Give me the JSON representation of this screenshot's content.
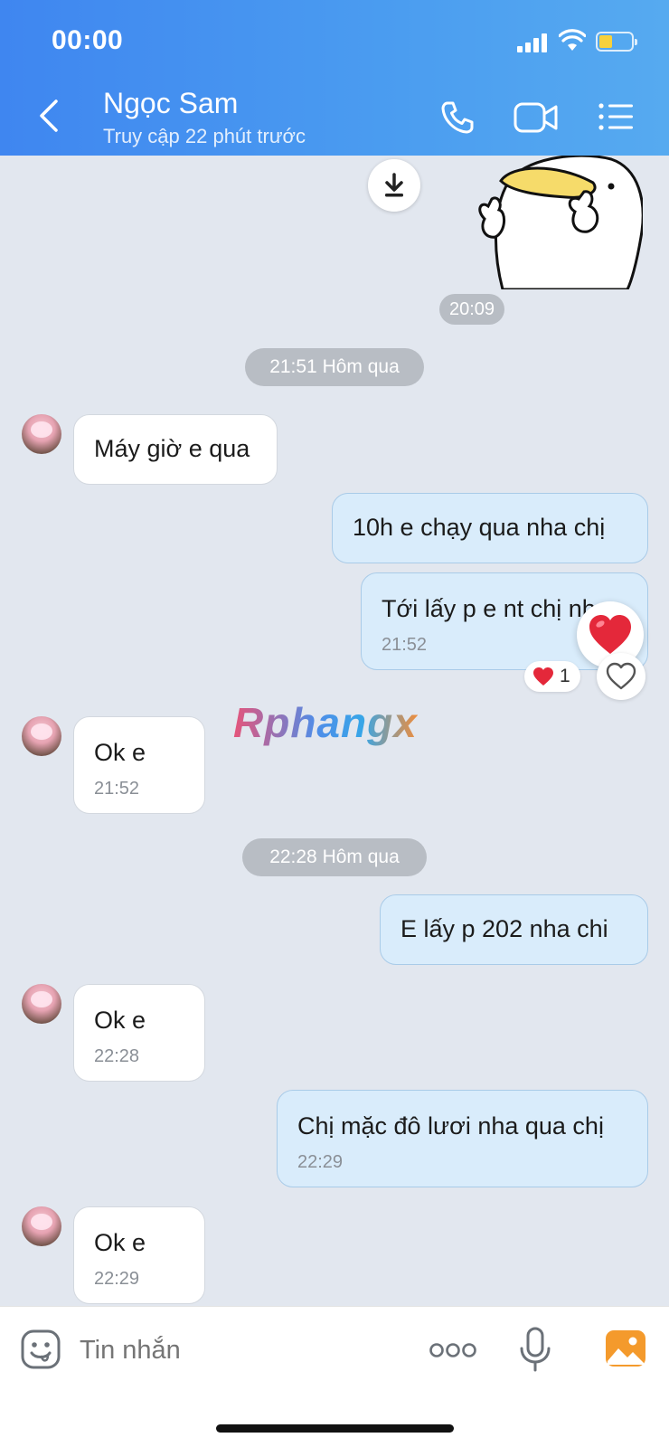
{
  "status_bar": {
    "time": "00:00"
  },
  "header": {
    "contact_name": "Ngọc Sam",
    "contact_status": "Truy cập 22 phút trước"
  },
  "messages": [
    {
      "type": "sticker",
      "direction": "out",
      "time": "20:09"
    },
    {
      "type": "divider",
      "text": "21:51 Hôm qua"
    },
    {
      "type": "text",
      "direction": "in",
      "text": "Máy giờ e qua"
    },
    {
      "type": "text",
      "direction": "out",
      "text": "10h e chạy qua nha chị"
    },
    {
      "type": "text",
      "direction": "out",
      "text": "Tới lấy p e nt chị nh",
      "time": "21:52",
      "reaction": {
        "emoji": "❤️",
        "count": "1"
      }
    },
    {
      "type": "text",
      "direction": "in",
      "text": "Ok e",
      "time": "21:52"
    },
    {
      "type": "divider",
      "text": "22:28 Hôm qua"
    },
    {
      "type": "text",
      "direction": "out",
      "text": "E lấy p 202 nha chi"
    },
    {
      "type": "text",
      "direction": "in",
      "text": "Ok e",
      "time": "22:28"
    },
    {
      "type": "text",
      "direction": "out",
      "text": "Chị mặc đô lươi nha qua chị",
      "time": "22:29"
    },
    {
      "type": "text",
      "direction": "in",
      "text": "Ok e",
      "time": "22:29"
    }
  ],
  "watermark": "Rphangx",
  "composer": {
    "placeholder": "Tin nhắn"
  },
  "icons": {
    "back": "chevron-left-icon",
    "call": "phone-icon",
    "video": "video-camera-icon",
    "menu": "list-menu-icon",
    "download": "download-icon",
    "emoji": "emoji-icon",
    "more": "more-dots-icon",
    "mic": "microphone-icon",
    "image": "image-gallery-icon"
  },
  "colors": {
    "header_start": "#3f86f0",
    "header_end": "#56aaf0",
    "chat_background": "#e2e7ef",
    "outgoing_bubble": "#d9ecfb",
    "incoming_bubble": "#ffffff",
    "reaction_heart": "#e4283a",
    "gallery_icon": "#f49a2c"
  }
}
